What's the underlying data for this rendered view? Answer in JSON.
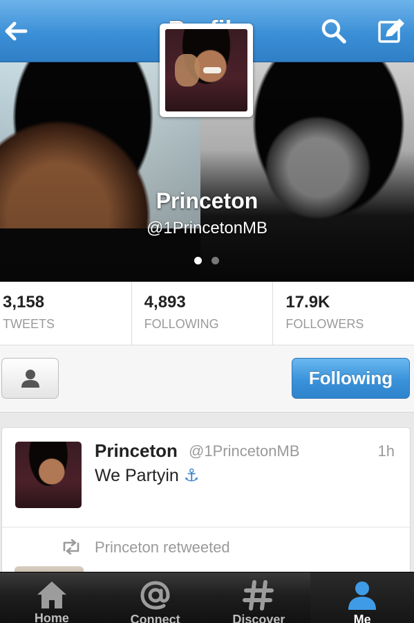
{
  "topbar": {
    "title": "Profile",
    "back_icon": "back-arrow-icon",
    "search_icon": "search-icon",
    "compose_icon": "compose-icon"
  },
  "profile": {
    "name": "Princeton",
    "handle": "@1PrincetonMB",
    "page_dots": 2,
    "active_dot": 0
  },
  "stats": [
    {
      "value": "3,158",
      "label": "TWEETS"
    },
    {
      "value": "4,893",
      "label": "FOLLOWING"
    },
    {
      "value": "17.9K",
      "label": "FOLLOWERS"
    }
  ],
  "actions": {
    "person_icon": "person-icon",
    "follow_label": "Following"
  },
  "tweet": {
    "name": "Princeton",
    "handle": "@1PrincetonMB",
    "time": "1h",
    "text": "We Partyin",
    "emoji": "⚓",
    "retweet_text": "Princeton retweeted"
  },
  "tabbar": {
    "tabs": [
      {
        "label": "Home",
        "icon": "home-icon"
      },
      {
        "label": "Connect",
        "icon": "at-icon"
      },
      {
        "label": "Discover",
        "icon": "hashtag-icon"
      },
      {
        "label": "Me",
        "icon": "person-icon"
      }
    ],
    "active_index": 3
  },
  "colors": {
    "accent": "#3a92d9",
    "tab_active": "#ffffff",
    "tab_inactive": "#bdbdbd"
  }
}
